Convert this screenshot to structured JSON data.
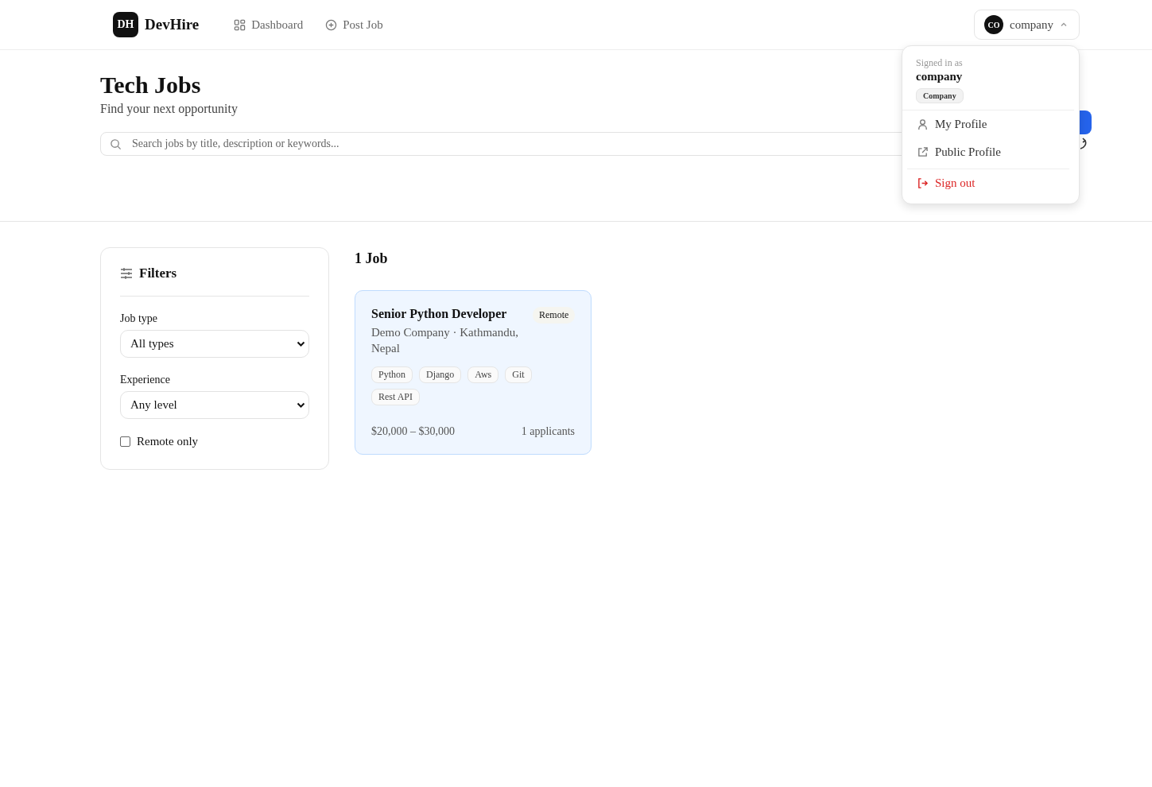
{
  "brand": {
    "logo": "DH",
    "name": "DevHire"
  },
  "nav": [
    {
      "label": "Dashboard"
    },
    {
      "label": "Post Job"
    }
  ],
  "user_menu": {
    "avatar": "CO",
    "name": "company",
    "expanded": true,
    "signed_in_label": "Signed in as",
    "signed_in_name": "company",
    "role": "Company",
    "items": [
      {
        "label": "My Profile",
        "kind": "normal"
      },
      {
        "label": "Public Profile",
        "kind": "normal"
      },
      {
        "label": "Sign out",
        "kind": "danger"
      }
    ]
  },
  "hero": {
    "title": "Tech Jobs",
    "subtitle": "Find your next opportunity"
  },
  "search": {
    "placeholder": "Search jobs by title, description or keywords..."
  },
  "filters": {
    "title": "Filters",
    "groups": [
      {
        "label": "Job type",
        "value": "All types"
      },
      {
        "label": "Experience",
        "value": "Any level"
      }
    ],
    "remote_only": {
      "label": "Remote only",
      "checked": false
    }
  },
  "results": {
    "count": "1 Job",
    "jobs": [
      {
        "title": "Senior Python Developer",
        "company": "Demo Company · Kathmandu, Nepal",
        "badge": "Remote",
        "tags": [
          "Python",
          "Django",
          "Aws",
          "Git",
          "Rest API"
        ],
        "salary": "$20,000 – $30,000",
        "applicants": "1 applicants"
      }
    ]
  }
}
